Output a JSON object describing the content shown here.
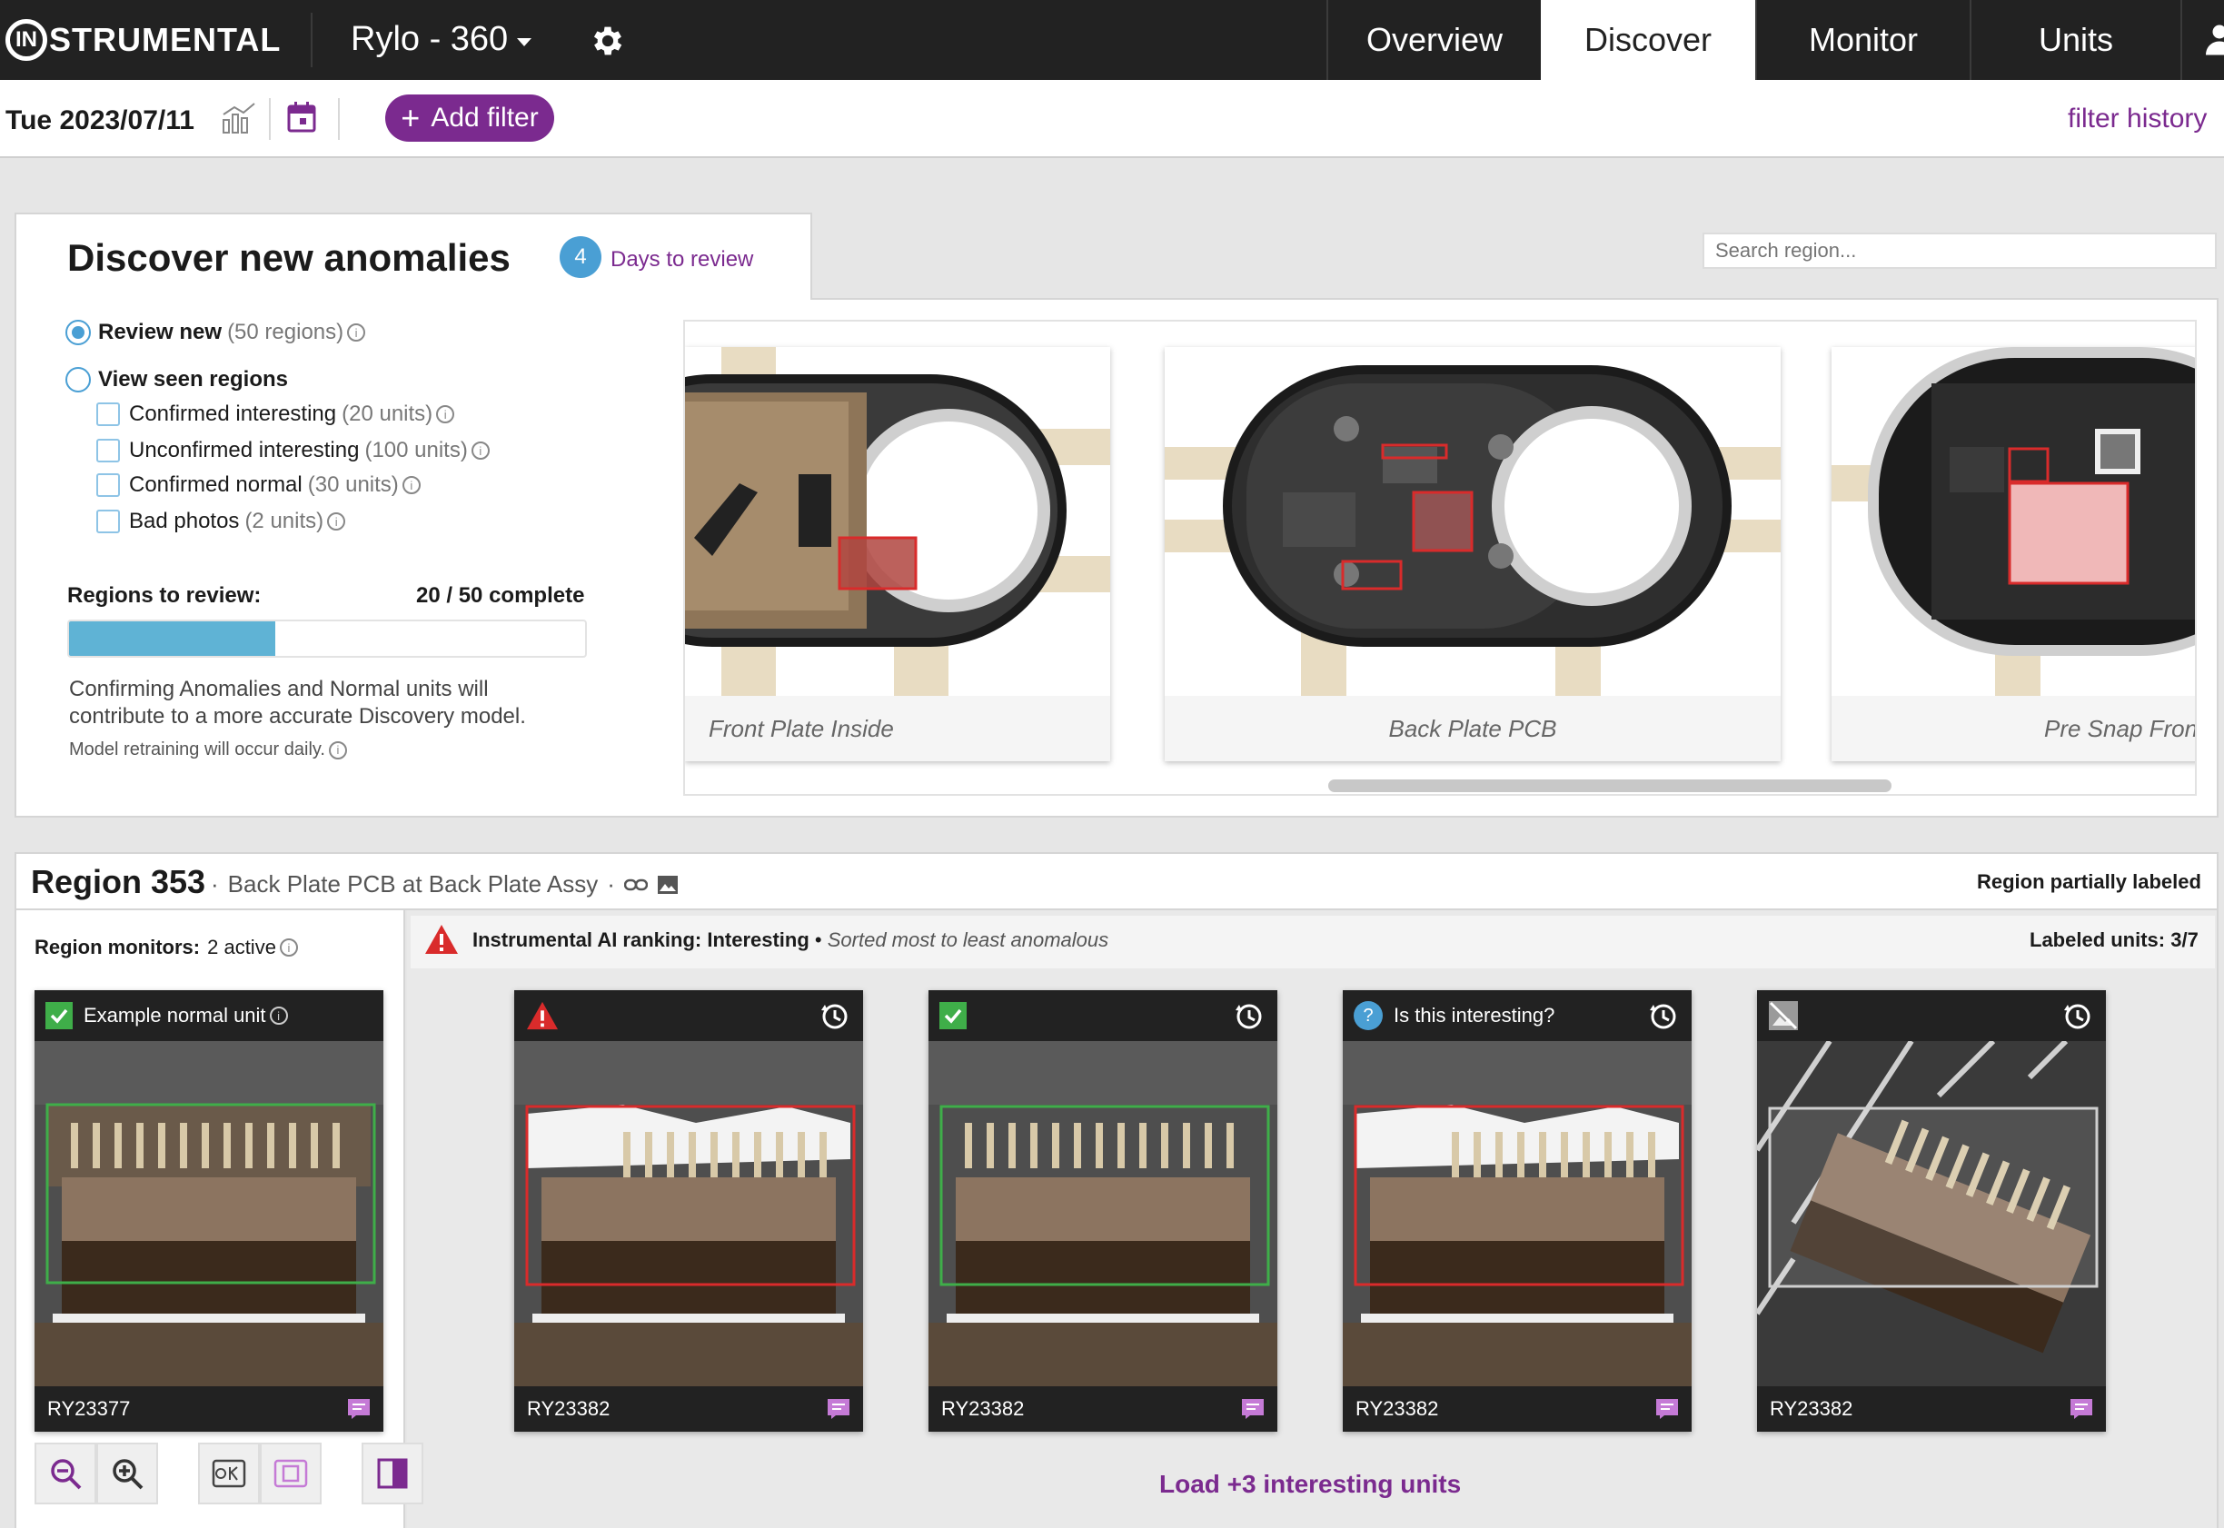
{
  "app": {
    "logo_o": "IN",
    "logo_text": "STRUMENTAL",
    "project": "Rylo - 360",
    "tabs": [
      {
        "label": "Overview"
      },
      {
        "label": "Discover"
      },
      {
        "label": "Monitor"
      },
      {
        "label": "Units"
      }
    ],
    "active_tab": "Discover"
  },
  "filterbar": {
    "date": "Tue 2023/07/11",
    "add_filter_label": "Add filter",
    "add_filter_plus": "+",
    "filter_history": "filter history"
  },
  "discover": {
    "title": "Discover new anomalies",
    "days_badge": "4",
    "days_text": "Days to review",
    "search_placeholder": "Search region...",
    "options": {
      "review_new_label": "Review new",
      "review_new_count": "(50 regions)",
      "view_seen_label": "View seen regions",
      "checks": [
        {
          "label": "Confirmed interesting",
          "count": "(20 units)"
        },
        {
          "label": "Unconfirmed interesting",
          "count": "(100 units)"
        },
        {
          "label": "Confirmed normal",
          "count": "(30 units)"
        },
        {
          "label": "Bad photos",
          "count": "(2 units)"
        }
      ]
    },
    "regions_to_review_label": "Regions to review:",
    "regions_to_review_value": "20 / 50 complete",
    "progress": 0.4,
    "help_text": "Confirming Anomalies and Normal units will contribute to a more accurate Discovery model.",
    "retrain_text": "Model retraining will occur daily.",
    "thumbnails": [
      {
        "caption": "Front Plate Inside"
      },
      {
        "caption": "Back Plate PCB"
      },
      {
        "caption": "Pre Snap Fron"
      }
    ]
  },
  "region": {
    "title": "Region 353",
    "dot": "·",
    "subtitle": "Back Plate PCB at Back Plate Assy",
    "dot2": "·",
    "status": "Region partially labeled",
    "monitors_label": "Region monitors:",
    "monitors_value": "2 active",
    "ai_ranking_label": "Instrumental AI ranking: Interesting",
    "ai_ranking_sep": " • ",
    "ai_ranking_sort": "Sorted most to least anomalous",
    "labeled_units": "Labeled units: 3/7",
    "example_card": {
      "header": "Example normal unit",
      "serial": "RY23377"
    },
    "cards": [
      {
        "status": "warning",
        "header": "",
        "serial": "RY23382"
      },
      {
        "status": "ok",
        "header": "",
        "serial": "RY23382"
      },
      {
        "status": "question",
        "header": "Is this interesting?",
        "serial": "RY23382"
      },
      {
        "status": "bad-photo",
        "header": "",
        "serial": "RY23382"
      }
    ],
    "load_more": "Load +3 interesting units"
  },
  "colors": {
    "accent_purple": "#7b2a8f",
    "accent_blue": "#4a9fd4",
    "ok_green": "#3fae49",
    "warn_red": "#d92b2b"
  },
  "icons": [
    "gear-icon",
    "user-icon",
    "chart-icon",
    "calendar-icon",
    "info-icon",
    "link-icon",
    "image-icon",
    "warning-icon",
    "history-icon",
    "note-icon",
    "zoom-out-icon",
    "zoom-in-icon",
    "ok-icon",
    "region-icon",
    "compare-icon"
  ]
}
